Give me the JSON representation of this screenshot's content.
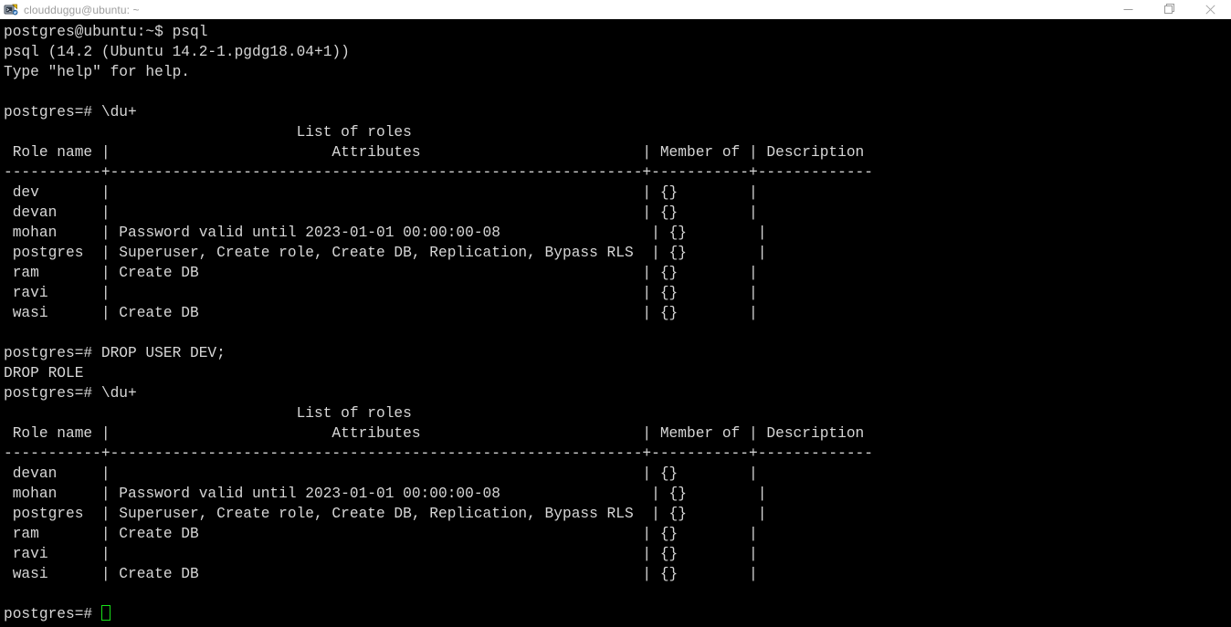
{
  "window": {
    "title": "cloudduggu@ubuntu: ~",
    "icon": "putty-terminal-icon",
    "controls": {
      "minimize": "minimize-icon",
      "maximize": "maximize-icon",
      "close": "close-icon"
    },
    "colors": {
      "titlebar_bg": "#ffffff",
      "title_text": "#9d9d9d",
      "terminal_bg": "#000000",
      "terminal_text": "#d6d6d6",
      "cursor": "#19e019"
    }
  },
  "terminal": {
    "prompt_shell": "postgres@ubuntu:~$",
    "prompt_psql": "postgres=#",
    "cursor_visible": true,
    "lines": [
      "postgres@ubuntu:~$ psql",
      "psql (14.2 (Ubuntu 14.2-1.pgdg18.04+1))",
      "Type \"help\" for help.",
      "",
      "postgres=# \\du+",
      "                                 List of roles",
      " Role name |                         Attributes                         | Member of | Description",
      "-----------+------------------------------------------------------------+-----------+-------------",
      " dev       |                                                            | {}        |",
      " devan     |                                                            | {}        |",
      " mohan     | Password valid until 2023-01-01 00:00:00-08                 | {}        |",
      " postgres  | Superuser, Create role, Create DB, Replication, Bypass RLS  | {}        |",
      " ram       | Create DB                                                  | {}        |",
      " ravi      |                                                            | {}        |",
      " wasi      | Create DB                                                  | {}        |",
      "",
      "postgres=# DROP USER DEV;",
      "DROP ROLE",
      "postgres=# \\du+",
      "                                 List of roles",
      " Role name |                         Attributes                         | Member of | Description",
      "-----------+------------------------------------------------------------+-----------+-------------",
      " devan     |                                                            | {}        |",
      " mohan     | Password valid until 2023-01-01 00:00:00-08                 | {}        |",
      " postgres  | Superuser, Create role, Create DB, Replication, Bypass RLS  | {}        |",
      " ram       | Create DB                                                  | {}        |",
      " ravi      |                                                            | {}        |",
      " wasi      | Create DB                                                  | {}        |",
      "",
      "postgres=# "
    ],
    "commands": [
      "psql",
      "\\du+",
      "DROP USER DEV;",
      "\\du+"
    ],
    "tables": [
      {
        "title": "List of roles",
        "columns": [
          "Role name",
          "Attributes",
          "Member of",
          "Description"
        ],
        "rows": [
          [
            "dev",
            "",
            "{}",
            ""
          ],
          [
            "devan",
            "",
            "{}",
            ""
          ],
          [
            "mohan",
            "Password valid until 2023-01-01 00:00:00-08",
            "{}",
            ""
          ],
          [
            "postgres",
            "Superuser, Create role, Create DB, Replication, Bypass RLS",
            "{}",
            ""
          ],
          [
            "ram",
            "Create DB",
            "{}",
            ""
          ],
          [
            "ravi",
            "",
            "{}",
            ""
          ],
          [
            "wasi",
            "Create DB",
            "{}",
            ""
          ]
        ]
      },
      {
        "title": "List of roles",
        "columns": [
          "Role name",
          "Attributes",
          "Member of",
          "Description"
        ],
        "rows": [
          [
            "devan",
            "",
            "{}",
            ""
          ],
          [
            "mohan",
            "Password valid until 2023-01-01 00:00:00-08",
            "{}",
            ""
          ],
          [
            "postgres",
            "Superuser, Create role, Create DB, Replication, Bypass RLS",
            "{}",
            ""
          ],
          [
            "ram",
            "Create DB",
            "{}",
            ""
          ],
          [
            "ravi",
            "",
            "{}",
            ""
          ],
          [
            "wasi",
            "Create DB",
            "{}",
            ""
          ]
        ]
      }
    ],
    "messages": [
      "DROP ROLE"
    ],
    "version_banner": "psql (14.2 (Ubuntu 14.2-1.pgdg18.04+1))",
    "help_hint": "Type \"help\" for help."
  }
}
